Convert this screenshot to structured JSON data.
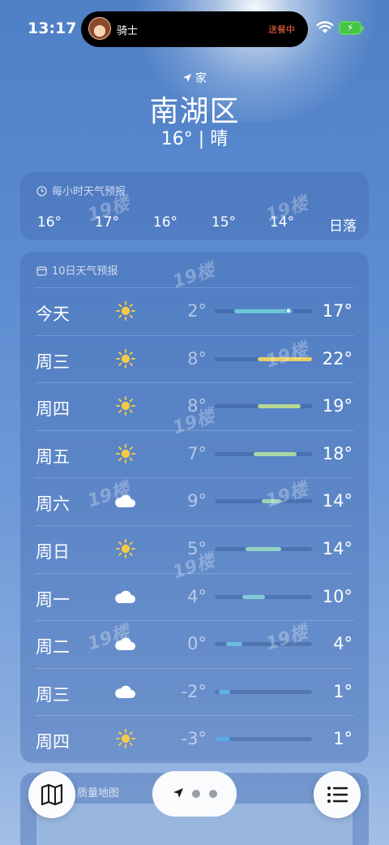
{
  "status_bar": {
    "time": "13:17",
    "island": {
      "rider_label": "骑士",
      "status_label": "送餐中"
    }
  },
  "location": {
    "tag": "家",
    "city": "南湖区",
    "current": "16° | 晴"
  },
  "hourly": {
    "title": "每小时天气预报",
    "items": [
      "16°",
      "17°",
      "16°",
      "15°",
      "14°",
      "日落"
    ]
  },
  "ten_day": {
    "title": "10日天气预报",
    "range_low": -3,
    "range_high": 22,
    "current_temp": 16,
    "rows": [
      {
        "day": "今天",
        "icon": "sun-icon",
        "low": "2°",
        "high": "17°",
        "low_v": 2,
        "high_v": 17,
        "color": "#6cc6d9",
        "current": true
      },
      {
        "day": "周三",
        "icon": "sun-icon",
        "low": "8°",
        "high": "22°",
        "low_v": 8,
        "high_v": 22,
        "color": "#e8cf64"
      },
      {
        "day": "周四",
        "icon": "sun-icon",
        "low": "8°",
        "high": "19°",
        "low_v": 8,
        "high_v": 19,
        "color": "#b8d792"
      },
      {
        "day": "周五",
        "icon": "sun-icon",
        "low": "7°",
        "high": "18°",
        "low_v": 7,
        "high_v": 18,
        "color": "#a9d6a4"
      },
      {
        "day": "周六",
        "icon": "cloud-icon",
        "low": "9°",
        "high": "14°",
        "low_v": 9,
        "high_v": 14,
        "color": "#9dd4b9"
      },
      {
        "day": "周日",
        "icon": "sun-icon",
        "low": "5°",
        "high": "14°",
        "low_v": 5,
        "high_v": 14,
        "color": "#92d2c4"
      },
      {
        "day": "周一",
        "icon": "cloud-icon",
        "low": "4°",
        "high": "10°",
        "low_v": 4,
        "high_v": 10,
        "color": "#82cad8"
      },
      {
        "day": "周二",
        "icon": "cloud-icon",
        "low": "0°",
        "high": "4°",
        "low_v": 0,
        "high_v": 4,
        "color": "#6cbde0"
      },
      {
        "day": "周三",
        "icon": "cloud-icon",
        "low": "-2°",
        "high": "1°",
        "low_v": -2,
        "high_v": 1,
        "color": "#62b2e4"
      },
      {
        "day": "周四",
        "icon": "sun-icon",
        "low": "-3°",
        "high": "1°",
        "low_v": -3,
        "high_v": 1,
        "color": "#5eaae6"
      }
    ]
  },
  "air_map": {
    "title": "质量地图"
  },
  "watermark": "19楼",
  "colors": {
    "sun": "#f6c945",
    "cloud": "#ffffff",
    "island_status": "#ff6a3d"
  }
}
